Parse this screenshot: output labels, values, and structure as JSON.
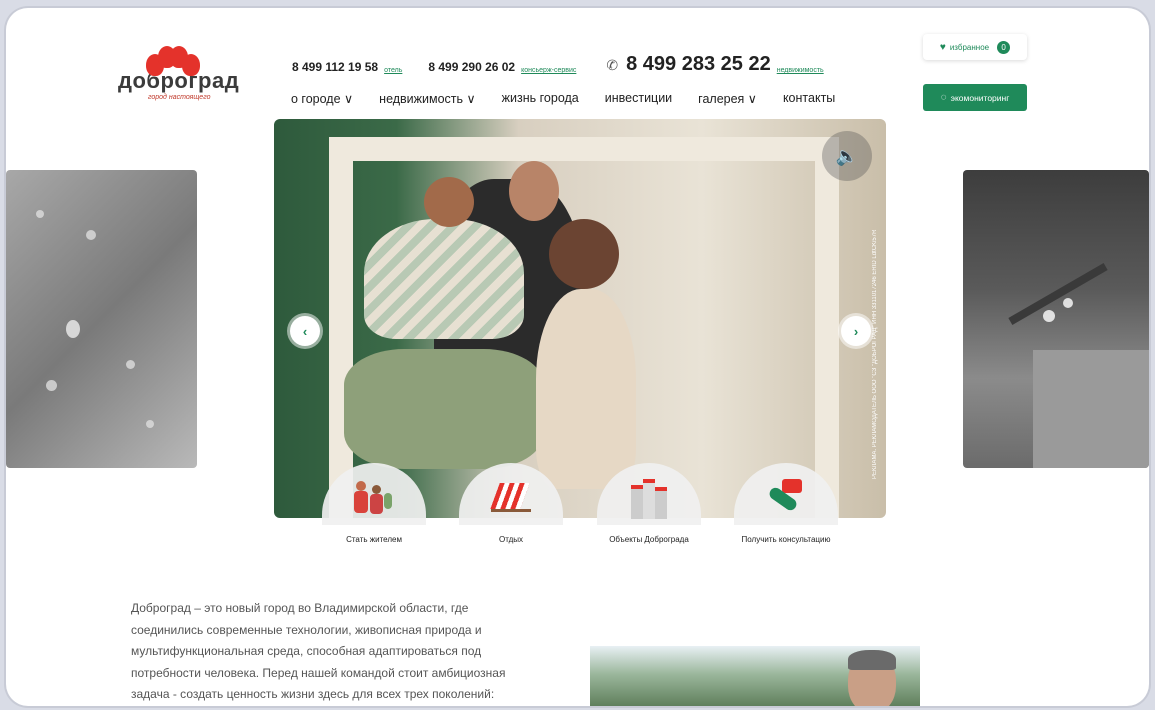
{
  "logo": {
    "name": "доброград",
    "tagline": "город настоящего"
  },
  "phones": [
    {
      "number": "8 499 112 19 58",
      "link": "отель"
    },
    {
      "number": "8 499 290 26 02",
      "link": "консьерж-сервис"
    }
  ],
  "main_phone": {
    "number": "8 499 283 25 22",
    "link": "недвижимость"
  },
  "favorites": {
    "label": "избранное",
    "count": "0"
  },
  "nav": [
    {
      "label": "о городе ∨"
    },
    {
      "label": "недвижимость ∨"
    },
    {
      "label": "жизнь города"
    },
    {
      "label": "инвестиции"
    },
    {
      "label": "галерея ∨"
    },
    {
      "label": "контакты"
    }
  ],
  "eco_button": {
    "label": "экомониторинг"
  },
  "hero": {
    "ad_text": "РЕКЛАМА. РЕКЛАМОДАТЕЛЬ ООО \"СЗ \"ДОБРОГРАД\" ИНН 3311017246 ERID LdtCKi57R",
    "sound_icon": "speaker-icon"
  },
  "cta": [
    {
      "label": "Стать жителем"
    },
    {
      "label": "Отдых"
    },
    {
      "label": "Объекты Доброграда"
    },
    {
      "label": "Получить консультацию"
    }
  ],
  "about_lines": [
    "Доброград – это новый город во Владимирской области, где",
    "соединились современные технологии, живописная природа и",
    "мультифункциональная среда, способная адаптироваться под",
    "потребности человека. Перед нашей командой стоит амбициозная",
    "задача - создать ценность жизни здесь для всех трех поколений:"
  ],
  "colors": {
    "brand_green": "#1f8a5a",
    "logo_red": "#e4322b"
  }
}
